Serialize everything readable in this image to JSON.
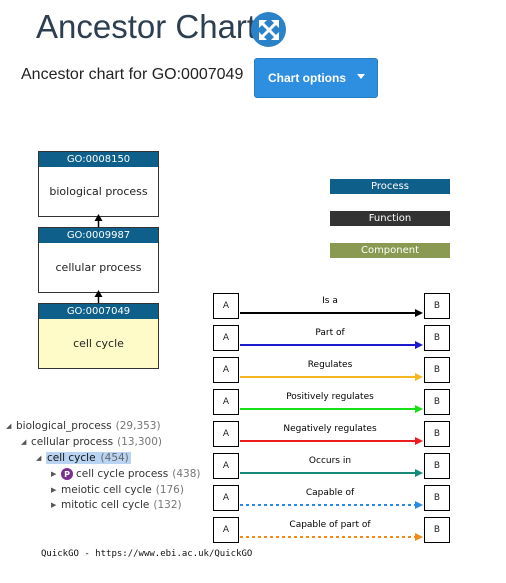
{
  "header": {
    "title": "Ancestor Chart",
    "expand_icon": "expand-arrows-icon"
  },
  "subtitle": "Ancestor chart for GO:0007049",
  "options_button": {
    "label": "Chart options",
    "icon": "caret-down-icon"
  },
  "nodes": [
    {
      "id": "GO:0008150",
      "name": "biological process"
    },
    {
      "id": "GO:0009987",
      "name": "cellular process"
    },
    {
      "id": "GO:0007049",
      "name": "cell cycle"
    }
  ],
  "legend": [
    {
      "label": "Process",
      "color": "#0e5f8a"
    },
    {
      "label": "Function",
      "color": "#333333"
    },
    {
      "label": "Component",
      "color": "#8a9a52"
    }
  ],
  "relations": [
    {
      "label": "Is a",
      "from": "A",
      "to": "B",
      "color": "#000000",
      "dashed": false
    },
    {
      "label": "Part of",
      "from": "A",
      "to": "B",
      "color": "#1a1acc",
      "dashed": false
    },
    {
      "label": "Regulates",
      "from": "A",
      "to": "B",
      "color": "#f5b820",
      "dashed": false
    },
    {
      "label": "Positively regulates",
      "from": "A",
      "to": "B",
      "color": "#18e018",
      "dashed": false
    },
    {
      "label": "Negatively regulates",
      "from": "A",
      "to": "B",
      "color": "#ee1c1c",
      "dashed": false
    },
    {
      "label": "Occurs in",
      "from": "A",
      "to": "B",
      "color": "#178a7a",
      "dashed": false
    },
    {
      "label": "Capable of",
      "from": "A",
      "to": "B",
      "color": "#2a8be0",
      "dashed": true
    },
    {
      "label": "Capable of part of",
      "from": "A",
      "to": "B",
      "color": "#f08a18",
      "dashed": true
    }
  ],
  "tree": [
    {
      "term": "biological_process",
      "count": "(29,353)",
      "level": 0,
      "expanded": true
    },
    {
      "term": "cellular process",
      "count": "(13,300)",
      "level": 1,
      "expanded": true
    },
    {
      "term": "cell cycle",
      "count": "(454)",
      "level": 2,
      "expanded": true,
      "selected": true
    },
    {
      "term": "cell cycle process",
      "count": "(438)",
      "level": 3,
      "expanded": false,
      "badge": "P"
    },
    {
      "term": "meiotic cell cycle",
      "count": "(176)",
      "level": 3,
      "expanded": false
    },
    {
      "term": "mitotic cell cycle",
      "count": "(132)",
      "level": 3,
      "expanded": false
    }
  ],
  "footer": "QuickGO - https://www.ebi.ac.uk/QuickGO"
}
